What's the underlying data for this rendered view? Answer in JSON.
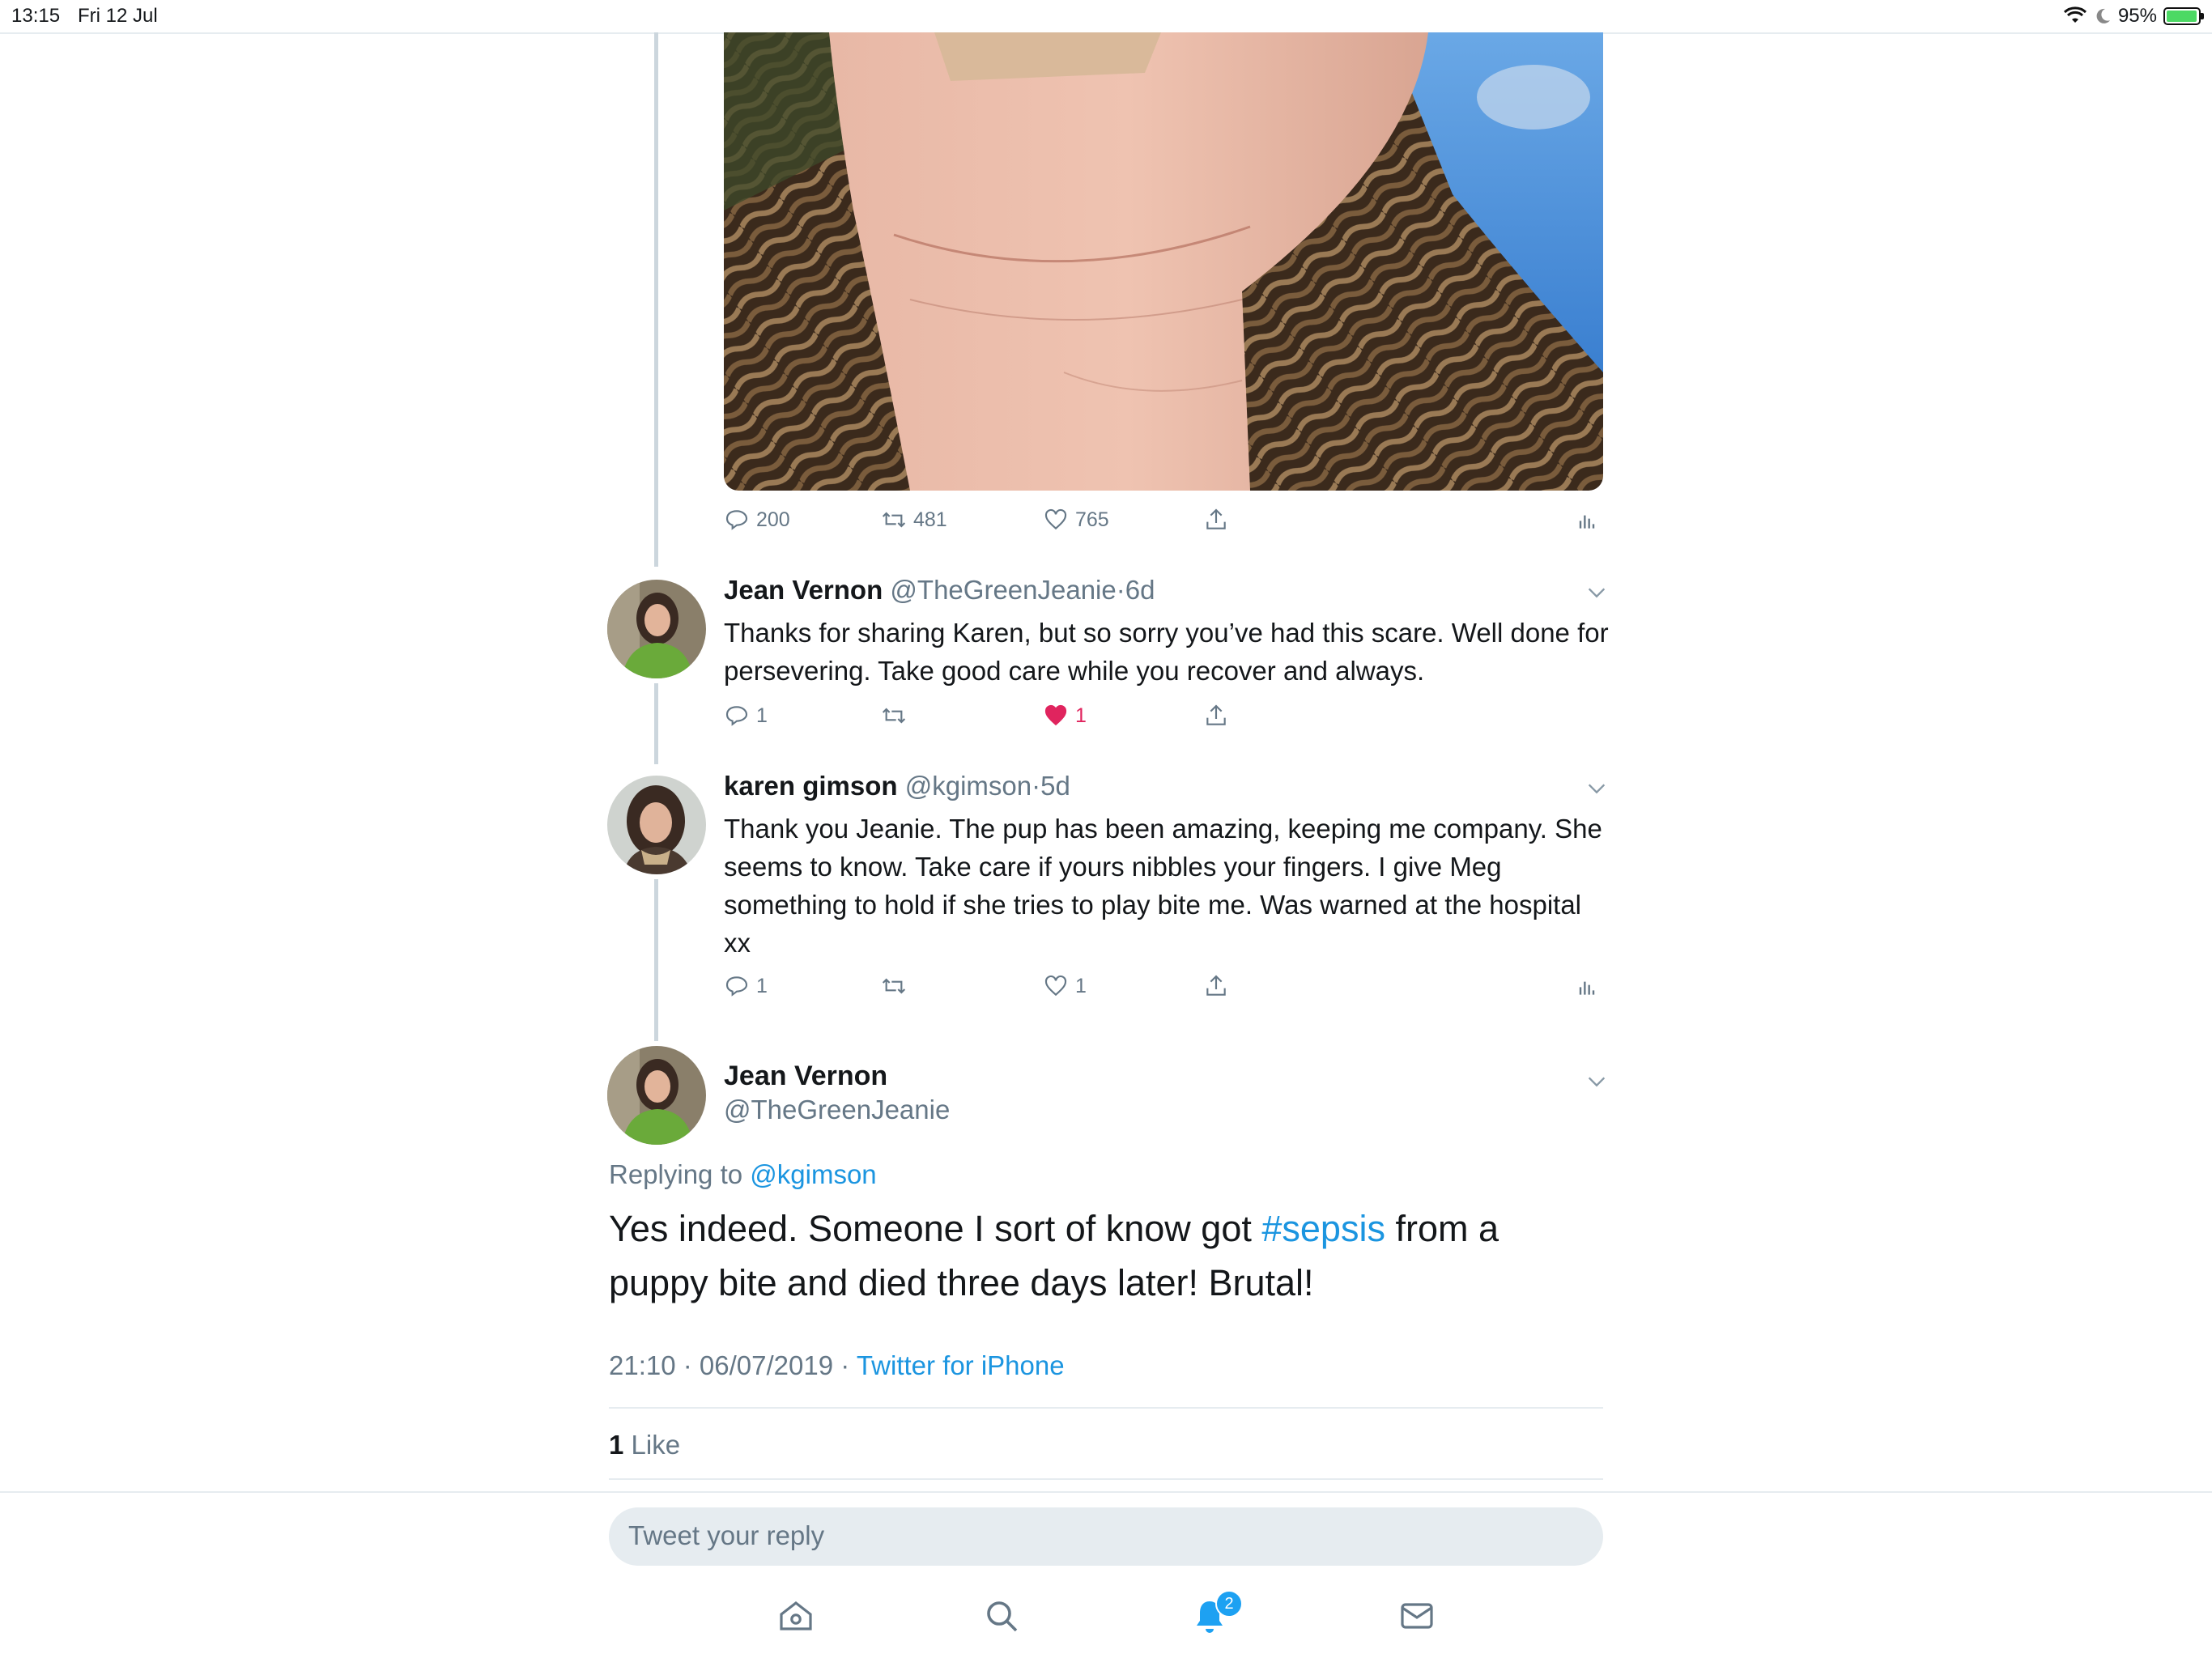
{
  "status_bar": {
    "time": "13:15",
    "date": "Fri 12 Jul",
    "battery": "95%",
    "battery_level": 0.95
  },
  "image_tweet": {
    "image_icon": "wrist-photo",
    "actions": {
      "replies": "200",
      "retweets": "481",
      "likes": "765"
    }
  },
  "reply_1": {
    "name": "Jean Vernon",
    "handle": "@TheGreenJeanie",
    "separator": "·",
    "ago": "6d",
    "text": "Thanks for sharing Karen, but so sorry  you’ve had this scare. Well done for persevering. Take good care while you recover and always.",
    "actions": {
      "replies": "1",
      "retweets": "",
      "likes": "1",
      "liked": true
    }
  },
  "reply_2": {
    "name": "karen gimson",
    "handle": "@kgimson",
    "separator": "·",
    "ago": "5d",
    "text": "Thank you Jeanie. The pup has been amazing, keeping me company. She seems to know. Take care if yours nibbles your fingers. I give Meg something to hold if she tries to play bite me. Was warned at the hospital xx",
    "actions": {
      "replies": "1",
      "retweets": "",
      "likes": "1",
      "liked": false
    }
  },
  "main_tweet": {
    "name": "Jean Vernon",
    "handle": "@TheGreenJeanie",
    "replying_prefix": "Replying to",
    "replying_handle": "@kgimson",
    "text_before": "Yes indeed. Someone I sort of know got",
    "hashtag": "#sepsis",
    "text_after": "from a puppy bite and died three days later! Brutal!",
    "timestamp": "21:10 · 06/07/2019 ·",
    "source": "Twitter for iPhone",
    "like_count": "1",
    "like_label": "Like"
  },
  "reply_box": {
    "placeholder": "Tweet your reply"
  },
  "tab_bar": {
    "items": [
      "home-icon",
      "search-icon",
      "notifications-icon",
      "messages-icon"
    ],
    "notification_badge": "2"
  },
  "colors": {
    "link": "#1b95e0",
    "like": "#e0245e",
    "muted": "#657786",
    "battery": "#4cd964"
  }
}
